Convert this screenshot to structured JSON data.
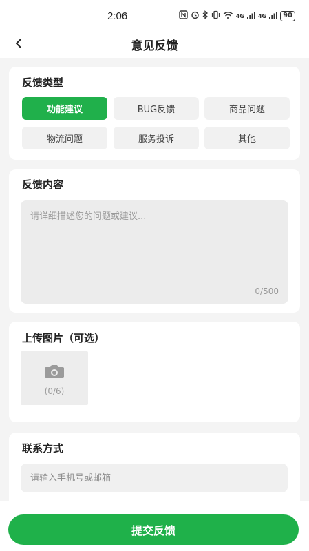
{
  "status_bar": {
    "time": "2:06",
    "icons": [
      "nfc-icon",
      "alarm-icon",
      "bluetooth-icon",
      "vibrate-icon",
      "wifi-icon",
      "signal-icon",
      "signal-icon"
    ],
    "network_label_1": "4G",
    "network_label_2": "4G",
    "battery": "90"
  },
  "nav": {
    "title": "意见反馈"
  },
  "feedback_type": {
    "title": "反馈类型",
    "options": [
      "功能建议",
      "BUG反馈",
      "商品问题",
      "物流问题",
      "服务投诉",
      "其他"
    ],
    "selected": "功能建议",
    "accent_color": "#20b04b"
  },
  "feedback_content": {
    "title": "反馈内容",
    "placeholder": "请详细描述您的问题或建议...",
    "counter": "0/500"
  },
  "upload": {
    "title": "上传图片（可选）",
    "count": "(0/6)"
  },
  "contact": {
    "title": "联系方式",
    "placeholder": "请输入手机号或邮箱"
  },
  "submit": {
    "label": "提交反馈"
  }
}
